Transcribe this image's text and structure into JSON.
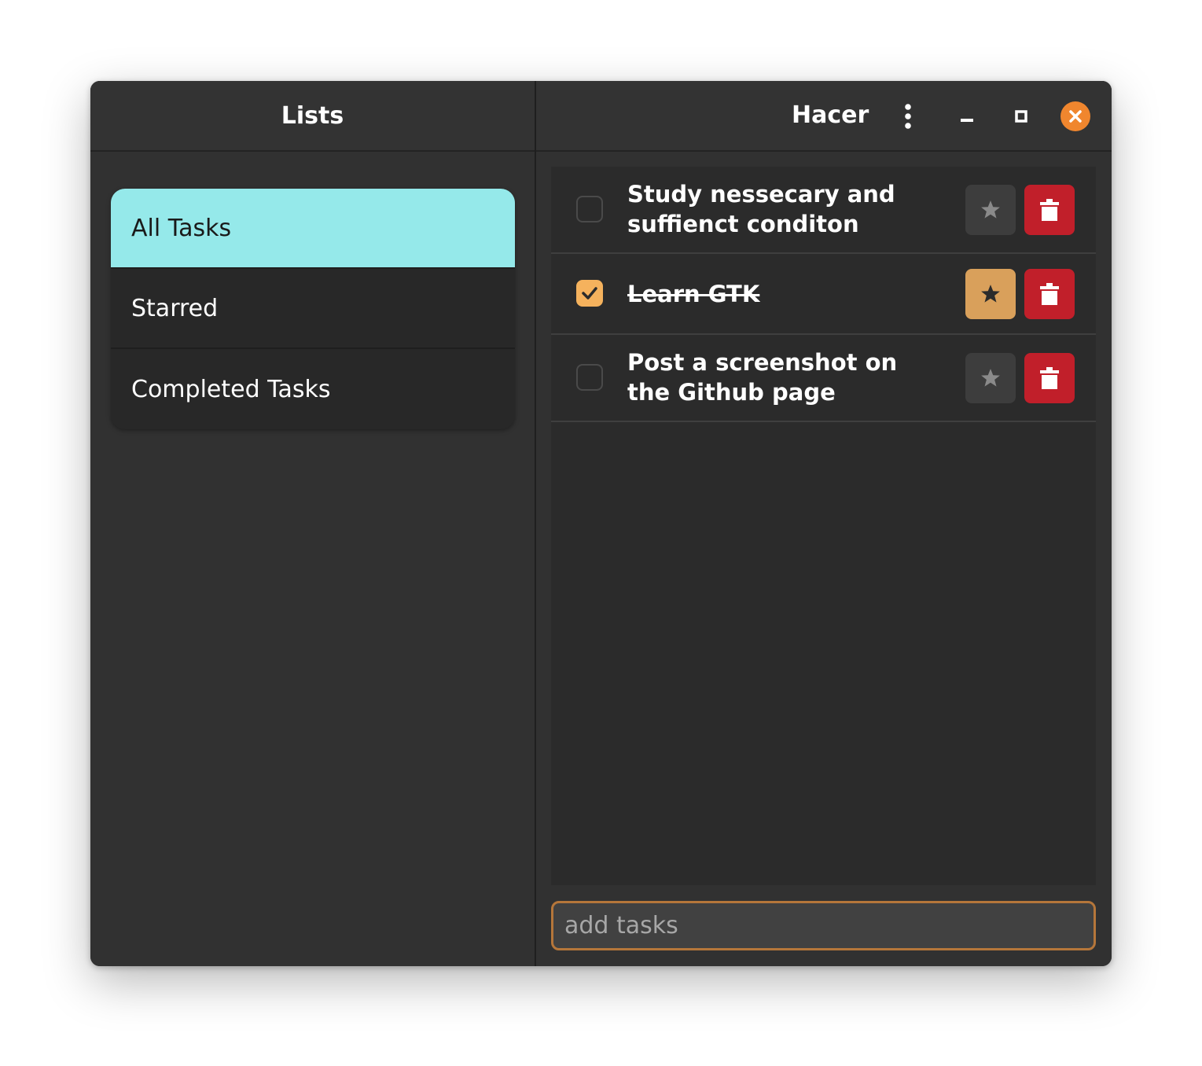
{
  "sidebar": {
    "title": "Lists",
    "items": [
      {
        "label": "All Tasks",
        "selected": true
      },
      {
        "label": "Starred",
        "selected": false
      },
      {
        "label": "Completed Tasks",
        "selected": false
      }
    ]
  },
  "header": {
    "title": "Hacer",
    "controls": [
      "menu-icon",
      "minimize-icon",
      "maximize-icon",
      "close-icon"
    ]
  },
  "tasks": [
    {
      "text": "Study nessecary and suffienct conditon",
      "completed": false,
      "starred": false
    },
    {
      "text": "Learn GTK",
      "completed": true,
      "starred": true
    },
    {
      "text": "Post a screenshot on the Github page",
      "completed": false,
      "starred": false
    }
  ],
  "input": {
    "placeholder": "add tasks",
    "value": ""
  },
  "colors": {
    "selected_list": "#95e9ea",
    "checkbox_checked": "#f5b25d",
    "star_active": "#d9a05b",
    "delete": "#c11f2a",
    "close_button": "#f0862e",
    "input_border": "#b5763a"
  }
}
